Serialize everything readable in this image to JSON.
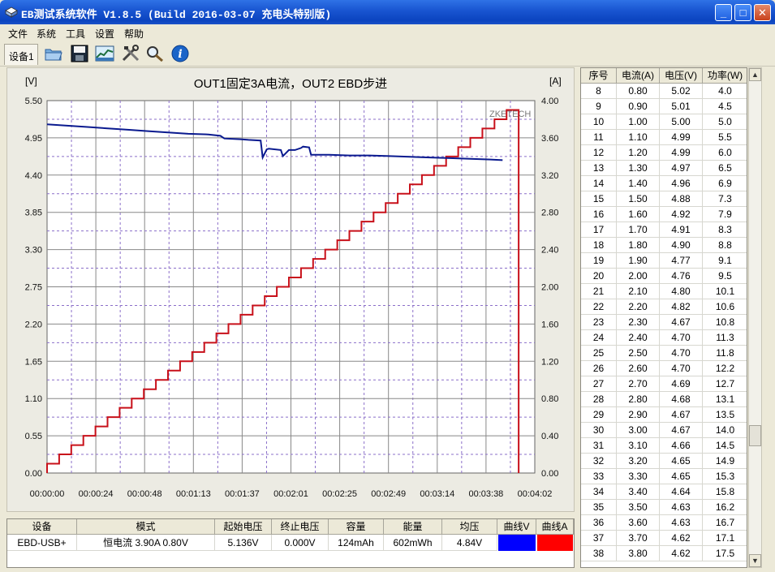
{
  "window": {
    "title": "EB测试系统软件 V1.8.5 (Build 2016-03-07 充电头特别版)",
    "minimize": "_",
    "maximize": "□",
    "close": "✕"
  },
  "menu": [
    "文件",
    "系统",
    "工具",
    "设置",
    "帮助"
  ],
  "toolbar": {
    "device_tab": "设备1",
    "buttons": [
      "open-folder-icon",
      "save-icon",
      "chart-view-icon",
      "tools-icon",
      "search-icon",
      "info-icon"
    ]
  },
  "chart_data": {
    "type": "line",
    "title": "OUT1固定3A电流，OUT2 EBD步进",
    "ylabel_left": "[V]",
    "ylabel_right": "[A]",
    "watermark": "ZKETECH",
    "ylim_left": [
      0,
      5.5
    ],
    "ylim_right": [
      0,
      4.0
    ],
    "yticks_left": [
      "0.00",
      "0.55",
      "1.10",
      "1.65",
      "2.20",
      "2.75",
      "3.30",
      "3.85",
      "4.40",
      "4.95",
      "5.50"
    ],
    "yticks_right": [
      "0.00",
      "0.40",
      "0.80",
      "1.20",
      "1.60",
      "2.00",
      "2.40",
      "2.80",
      "3.20",
      "3.60",
      "4.00"
    ],
    "xlim_seconds": [
      0,
      242
    ],
    "xticks": [
      "00:00:00",
      "00:00:24",
      "00:00:48",
      "00:01:13",
      "00:01:37",
      "00:02:01",
      "00:02:25",
      "00:02:49",
      "00:03:14",
      "00:03:38",
      "00:04:02"
    ],
    "grid": true,
    "series": [
      {
        "name": "曲线V",
        "axis": "left",
        "color": "#0a1a8f",
        "t_seconds": [
          0,
          10,
          20,
          30,
          40,
          50,
          60,
          70,
          80,
          86,
          88,
          96,
          100,
          106,
          107,
          109,
          110,
          116,
          117,
          120,
          123,
          126,
          127,
          130,
          131,
          140,
          150,
          160,
          170,
          180,
          190,
          200,
          210,
          220,
          226
        ],
        "values": [
          5.15,
          5.13,
          5.11,
          5.09,
          5.07,
          5.05,
          5.03,
          5.01,
          5.0,
          4.98,
          4.94,
          4.93,
          4.92,
          4.91,
          4.66,
          4.78,
          4.79,
          4.77,
          4.68,
          4.77,
          4.77,
          4.8,
          4.82,
          4.81,
          4.7,
          4.7,
          4.69,
          4.69,
          4.68,
          4.67,
          4.66,
          4.65,
          4.64,
          4.63,
          4.62
        ]
      },
      {
        "name": "曲线A",
        "axis": "right",
        "color": "#c8101a",
        "step_seconds": 6,
        "start_current": 0.1,
        "step_current": 0.1,
        "values": [
          0.1,
          0.2,
          0.3,
          0.4,
          0.5,
          0.6,
          0.7,
          0.8,
          0.9,
          1.0,
          1.1,
          1.2,
          1.3,
          1.4,
          1.5,
          1.6,
          1.7,
          1.8,
          1.9,
          2.0,
          2.1,
          2.2,
          2.3,
          2.4,
          2.5,
          2.6,
          2.7,
          2.8,
          2.9,
          3.0,
          3.1,
          3.2,
          3.3,
          3.4,
          3.5,
          3.6,
          3.7,
          3.8,
          3.9
        ],
        "drop_to": 0.0
      }
    ]
  },
  "table": {
    "headers": [
      "序号",
      "电流(A)",
      "电压(V)",
      "功率(W)"
    ],
    "rows": [
      [
        "8",
        "0.80",
        "5.02",
        "4.0"
      ],
      [
        "9",
        "0.90",
        "5.01",
        "4.5"
      ],
      [
        "10",
        "1.00",
        "5.00",
        "5.0"
      ],
      [
        "11",
        "1.10",
        "4.99",
        "5.5"
      ],
      [
        "12",
        "1.20",
        "4.99",
        "6.0"
      ],
      [
        "13",
        "1.30",
        "4.97",
        "6.5"
      ],
      [
        "14",
        "1.40",
        "4.96",
        "6.9"
      ],
      [
        "15",
        "1.50",
        "4.88",
        "7.3"
      ],
      [
        "16",
        "1.60",
        "4.92",
        "7.9"
      ],
      [
        "17",
        "1.70",
        "4.91",
        "8.3"
      ],
      [
        "18",
        "1.80",
        "4.90",
        "8.8"
      ],
      [
        "19",
        "1.90",
        "4.77",
        "9.1"
      ],
      [
        "20",
        "2.00",
        "4.76",
        "9.5"
      ],
      [
        "21",
        "2.10",
        "4.80",
        "10.1"
      ],
      [
        "22",
        "2.20",
        "4.82",
        "10.6"
      ],
      [
        "23",
        "2.30",
        "4.67",
        "10.8"
      ],
      [
        "24",
        "2.40",
        "4.70",
        "11.3"
      ],
      [
        "25",
        "2.50",
        "4.70",
        "11.8"
      ],
      [
        "26",
        "2.60",
        "4.70",
        "12.2"
      ],
      [
        "27",
        "2.70",
        "4.69",
        "12.7"
      ],
      [
        "28",
        "2.80",
        "4.68",
        "13.1"
      ],
      [
        "29",
        "2.90",
        "4.67",
        "13.5"
      ],
      [
        "30",
        "3.00",
        "4.67",
        "14.0"
      ],
      [
        "31",
        "3.10",
        "4.66",
        "14.5"
      ],
      [
        "32",
        "3.20",
        "4.65",
        "14.9"
      ],
      [
        "33",
        "3.30",
        "4.65",
        "15.3"
      ],
      [
        "34",
        "3.40",
        "4.64",
        "15.8"
      ],
      [
        "35",
        "3.50",
        "4.63",
        "16.2"
      ],
      [
        "36",
        "3.60",
        "4.63",
        "16.7"
      ],
      [
        "37",
        "3.70",
        "4.62",
        "17.1"
      ],
      [
        "38",
        "3.80",
        "4.62",
        "17.5"
      ]
    ]
  },
  "summary": {
    "headers": [
      "设备",
      "模式",
      "起始电压",
      "终止电压",
      "容量",
      "能量",
      "均压",
      "曲线V",
      "曲线A"
    ],
    "row": {
      "device": "EBD-USB+",
      "mode": "恒电流  3.90A  0.80V",
      "start_voltage": "5.136V",
      "end_voltage": "0.000V",
      "capacity": "124mAh",
      "energy": "602mWh",
      "avg_voltage": "4.84V",
      "curve_v_color": "#0000ff",
      "curve_a_color": "#ff0000"
    }
  }
}
